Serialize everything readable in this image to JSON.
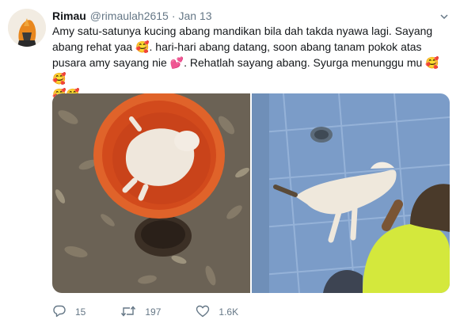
{
  "tweet": {
    "display_name": "Rimau",
    "handle": "@rimaulah2615",
    "separator": "·",
    "date": "Jan 13",
    "text_lines": [
      "Amy satu-satunya kucing abang mandikan bila dah takda nyawa lagi.  Sayang",
      "abang rehat yaa 🥰. hari-hari abang datang, soon abang tanam pokok atas",
      "pusara amy sayang nie 💕. Rehatlah sayang abang. Syurga menunggu mu 🥰🥰",
      "🥰🥰"
    ],
    "actions": {
      "replies": "15",
      "retweets": "197",
      "likes": "1.6K"
    }
  },
  "icons": {
    "caret": "chevron-down-icon",
    "reply": "reply-icon",
    "retweet": "retweet-icon",
    "like": "heart-icon"
  },
  "colors": {
    "secondary_text": "#657786",
    "primary_text": "#14171a"
  }
}
